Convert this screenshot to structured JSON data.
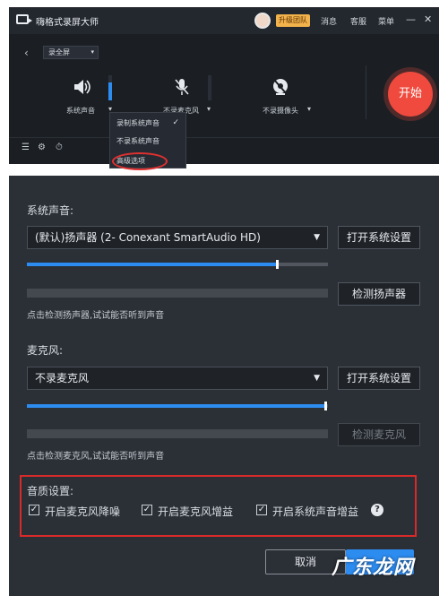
{
  "top": {
    "app_title": "嗨格式录屏大师",
    "upgrade_badge": "升级团队",
    "menu": [
      "消息",
      "客服",
      "菜单"
    ],
    "window_controls": [
      "—",
      "✕"
    ],
    "back_icon": "‹",
    "mode_select": "录全屏",
    "devices": [
      {
        "label": "系统声音",
        "icon": "speaker-icon",
        "level": 0.7
      },
      {
        "label": "不录麦克风",
        "icon": "mic-muted-icon",
        "level": 0.0
      },
      {
        "label": "不录摄像头",
        "icon": "camera-off-icon"
      }
    ],
    "start_button": "开始",
    "dropdown": {
      "items": [
        "录制系统声音",
        "不录系统声音",
        "高级选项"
      ],
      "checked": "录制系统声音"
    }
  },
  "panel": {
    "system_sound": {
      "label": "系统声音:",
      "device": "(默认)扬声器 (2- Conexant SmartAudio HD)",
      "open_settings": "打开系统设置",
      "volume": 0.83,
      "test_button": "检测扬声器",
      "hint": "点击检测扬声器,试试能否听到声音"
    },
    "microphone": {
      "label": "麦克风:",
      "device": "不录麦克风",
      "open_settings": "打开系统设置",
      "volume": 0.99,
      "test_button": "检测麦克风",
      "hint": "点击检测麦克风,试试能否听到声音"
    },
    "quality": {
      "label": "音质设置:",
      "options": [
        {
          "label": "开启麦克风降噪",
          "checked": true
        },
        {
          "label": "开启麦克风增益",
          "checked": true
        },
        {
          "label": "开启系统声音增益",
          "checked": true
        }
      ],
      "help_icon": "?"
    },
    "cancel_button": "取消",
    "watermark": "广东龙网"
  },
  "colors": {
    "accent": "#2d8cf0",
    "start": "#ef4a3d",
    "highlight": "#d92a2a"
  }
}
